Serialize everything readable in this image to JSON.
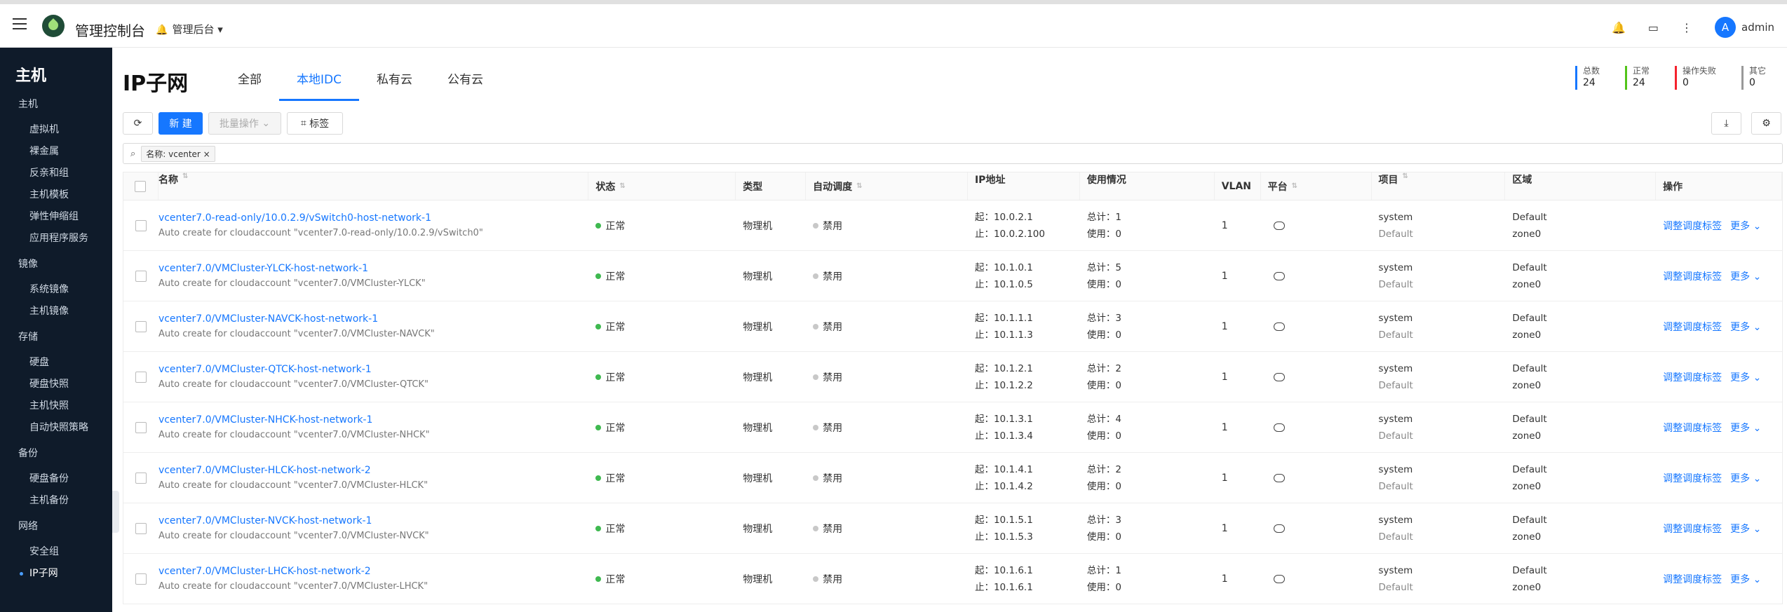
{
  "header": {
    "app_title": "管理控制台",
    "console_switch": "管理后台",
    "user": "admin",
    "avatar_letter": "A"
  },
  "sidebar": {
    "title": "主机",
    "groups": [
      {
        "label": "主机",
        "items": [
          "虚拟机",
          "裸金属",
          "反亲和组",
          "主机模板",
          "弹性伸缩组",
          "应用程序服务"
        ]
      },
      {
        "label": "镜像",
        "items": [
          "系统镜像",
          "主机镜像"
        ]
      },
      {
        "label": "存储",
        "items": [
          "硬盘",
          "硬盘快照",
          "主机快照",
          "自动快照策略"
        ]
      },
      {
        "label": "备份",
        "items": [
          "硬盘备份",
          "主机备份"
        ]
      },
      {
        "label": "网络",
        "items": [
          "安全组",
          "IP子网"
        ]
      }
    ],
    "active_item": "IP子网"
  },
  "page": {
    "title": "IP子网",
    "tabs": [
      "全部",
      "本地IDC",
      "私有云",
      "公有云"
    ],
    "active_tab": "本地IDC",
    "stats": [
      {
        "label": "总数",
        "value": "24",
        "color": "#1677ff"
      },
      {
        "label": "正常",
        "value": "24",
        "color": "#52c41a"
      },
      {
        "label": "操作失败",
        "value": "0",
        "color": "#f5222d"
      },
      {
        "label": "其它",
        "value": "0",
        "color": "#999999"
      }
    ],
    "toolbar": {
      "new": "新 建",
      "batch": "批量操作",
      "tag": "标签"
    },
    "filter_chip": "名称: vcenter"
  },
  "table": {
    "columns": [
      "名称",
      "状态",
      "类型",
      "自动调度",
      "IP地址",
      "使用情况",
      "VLAN",
      "平台",
      "项目",
      "区域",
      "操作"
    ],
    "rows": [
      {
        "name": "vcenter7.0-read-only/10.0.2.9/vSwitch0-host-network-1",
        "desc": "Auto create for cloudaccount \"vcenter7.0-read-only/10.0.2.9/vSwitch0\"",
        "status": "正常",
        "type": "物理机",
        "sched": "禁用",
        "ip_start": "起：10.0.2.1",
        "ip_end": "止：10.0.2.100",
        "total": "总计：1",
        "used": "使用：0",
        "vlan": "1",
        "project": "system",
        "project_domain": "Default",
        "domain": "Default",
        "zone": "zone0"
      },
      {
        "name": "vcenter7.0/VMCluster-YLCK-host-network-1",
        "desc": "Auto create for cloudaccount \"vcenter7.0/VMCluster-YLCK\"",
        "status": "正常",
        "type": "物理机",
        "sched": "禁用",
        "ip_start": "起：10.1.0.1",
        "ip_end": "止：10.1.0.5",
        "total": "总计：5",
        "used": "使用：0",
        "vlan": "1",
        "project": "system",
        "project_domain": "Default",
        "domain": "Default",
        "zone": "zone0"
      },
      {
        "name": "vcenter7.0/VMCluster-NAVCK-host-network-1",
        "desc": "Auto create for cloudaccount \"vcenter7.0/VMCluster-NAVCK\"",
        "status": "正常",
        "type": "物理机",
        "sched": "禁用",
        "ip_start": "起：10.1.1.1",
        "ip_end": "止：10.1.1.3",
        "total": "总计：3",
        "used": "使用：0",
        "vlan": "1",
        "project": "system",
        "project_domain": "Default",
        "domain": "Default",
        "zone": "zone0"
      },
      {
        "name": "vcenter7.0/VMCluster-QTCK-host-network-1",
        "desc": "Auto create for cloudaccount \"vcenter7.0/VMCluster-QTCK\"",
        "status": "正常",
        "type": "物理机",
        "sched": "禁用",
        "ip_start": "起：10.1.2.1",
        "ip_end": "止：10.1.2.2",
        "total": "总计：2",
        "used": "使用：0",
        "vlan": "1",
        "project": "system",
        "project_domain": "Default",
        "domain": "Default",
        "zone": "zone0"
      },
      {
        "name": "vcenter7.0/VMCluster-NHCK-host-network-1",
        "desc": "Auto create for cloudaccount \"vcenter7.0/VMCluster-NHCK\"",
        "status": "正常",
        "type": "物理机",
        "sched": "禁用",
        "ip_start": "起：10.1.3.1",
        "ip_end": "止：10.1.3.4",
        "total": "总计：4",
        "used": "使用：0",
        "vlan": "1",
        "project": "system",
        "project_domain": "Default",
        "domain": "Default",
        "zone": "zone0"
      },
      {
        "name": "vcenter7.0/VMCluster-HLCK-host-network-2",
        "desc": "Auto create for cloudaccount \"vcenter7.0/VMCluster-HLCK\"",
        "status": "正常",
        "type": "物理机",
        "sched": "禁用",
        "ip_start": "起：10.1.4.1",
        "ip_end": "止：10.1.4.2",
        "total": "总计：2",
        "used": "使用：0",
        "vlan": "1",
        "project": "system",
        "project_domain": "Default",
        "domain": "Default",
        "zone": "zone0"
      },
      {
        "name": "vcenter7.0/VMCluster-NVCK-host-network-1",
        "desc": "Auto create for cloudaccount \"vcenter7.0/VMCluster-NVCK\"",
        "status": "正常",
        "type": "物理机",
        "sched": "禁用",
        "ip_start": "起：10.1.5.1",
        "ip_end": "止：10.1.5.3",
        "total": "总计：3",
        "used": "使用：0",
        "vlan": "1",
        "project": "system",
        "project_domain": "Default",
        "domain": "Default",
        "zone": "zone0"
      },
      {
        "name": "vcenter7.0/VMCluster-LHCK-host-network-2",
        "desc": "Auto create for cloudaccount \"vcenter7.0/VMCluster-LHCK\"",
        "status": "正常",
        "type": "物理机",
        "sched": "禁用",
        "ip_start": "起：10.1.6.1",
        "ip_end": "止：10.1.6.1",
        "total": "总计：1",
        "used": "使用：0",
        "vlan": "1",
        "project": "system",
        "project_domain": "Default",
        "domain": "Default",
        "zone": "zone0"
      }
    ],
    "ops": {
      "primary": "调整调度标签",
      "more": "更多"
    }
  }
}
